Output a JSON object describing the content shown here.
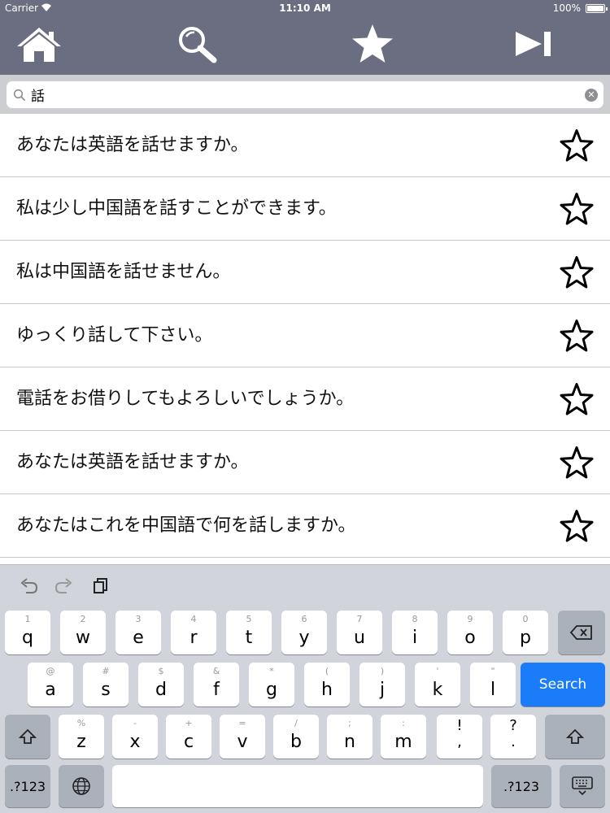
{
  "status_bar": {
    "carrier": "Carrier",
    "time": "11:10 AM",
    "battery": "100%"
  },
  "toolbar": {
    "items": [
      {
        "name": "home",
        "icon": "home-icon"
      },
      {
        "name": "search",
        "icon": "search-icon"
      },
      {
        "name": "favorites",
        "icon": "star-icon"
      },
      {
        "name": "next",
        "icon": "play-next-icon"
      }
    ]
  },
  "search": {
    "value": "話",
    "clear_icon": "clear-icon"
  },
  "results": [
    "あなたは英語を話せますか。",
    "私は少し中国語を話すことができます。",
    "私は中国語を話せません。",
    "ゆっくり話して下さい。",
    "電話をお借りしてもよろしいでしょうか。",
    "あなたは英語を話せますか。",
    "あなたはこれを中国語で何を話しますか。"
  ],
  "keyboard": {
    "row1": [
      {
        "hint": "1",
        "key": "q"
      },
      {
        "hint": "2",
        "key": "w"
      },
      {
        "hint": "3",
        "key": "e"
      },
      {
        "hint": "4",
        "key": "r"
      },
      {
        "hint": "5",
        "key": "t"
      },
      {
        "hint": "6",
        "key": "y"
      },
      {
        "hint": "7",
        "key": "u"
      },
      {
        "hint": "8",
        "key": "i"
      },
      {
        "hint": "9",
        "key": "o"
      },
      {
        "hint": "0",
        "key": "p"
      }
    ],
    "row2": [
      {
        "hint": "@",
        "key": "a"
      },
      {
        "hint": "#",
        "key": "s"
      },
      {
        "hint": "$",
        "key": "d"
      },
      {
        "hint": "&",
        "key": "f"
      },
      {
        "hint": "*",
        "key": "g"
      },
      {
        "hint": "(",
        "key": "h"
      },
      {
        "hint": ")",
        "key": "j"
      },
      {
        "hint": "'",
        "key": "k"
      },
      {
        "hint": "\"",
        "key": "l"
      }
    ],
    "row3": [
      {
        "hint": "%",
        "key": "z"
      },
      {
        "hint": "-",
        "key": "x"
      },
      {
        "hint": "+",
        "key": "c"
      },
      {
        "hint": "=",
        "key": "v"
      },
      {
        "hint": "/",
        "key": "b"
      },
      {
        "hint": ";",
        "key": "n"
      },
      {
        "hint": ":",
        "key": "m"
      }
    ],
    "punct_1": {
      "top": "!",
      "bottom": ","
    },
    "punct_2": {
      "top": "?",
      "bottom": "."
    },
    "search_label": "Search",
    "numbers_label": ".?123"
  },
  "colors": {
    "toolbar": "#6b6e80",
    "search_key": "#1a7cf8",
    "keyboard_bg": "#d1d4db"
  }
}
